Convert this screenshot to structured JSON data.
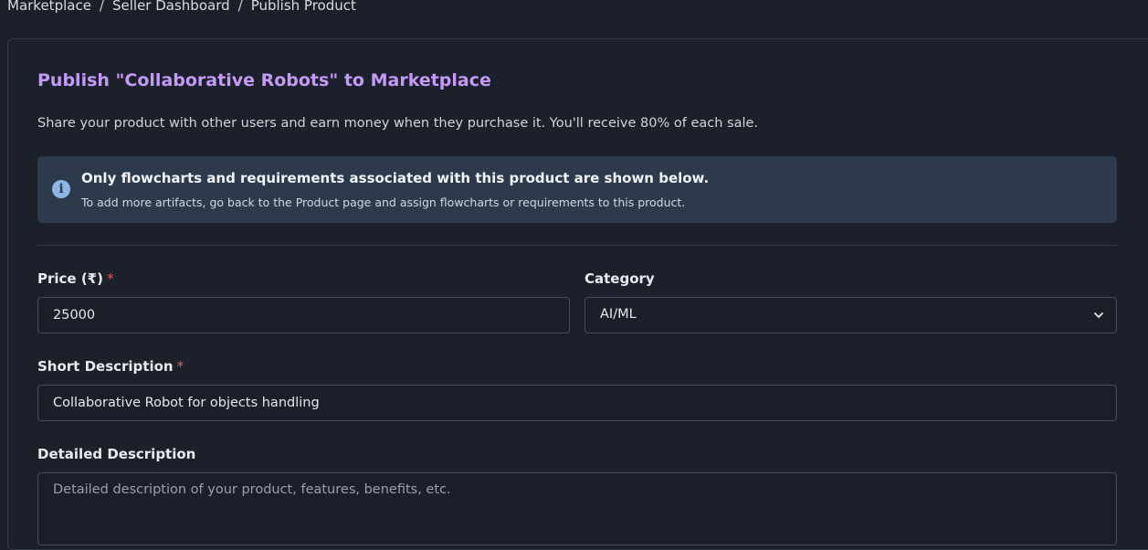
{
  "breadcrumb": {
    "items": [
      "Marketplace",
      "Seller Dashboard",
      "Publish Product"
    ],
    "separator": "/"
  },
  "header": {
    "title": "Publish \"Collaborative Robots\" to Marketplace",
    "subtitle": "Share your product with other users and earn money when they purchase it. You'll receive 80% of each sale."
  },
  "alert": {
    "icon": "info-icon",
    "title": "Only flowcharts and requirements associated with this product are shown below.",
    "body": "To add more artifacts, go back to the Product page and assign flowcharts or requirements to this product."
  },
  "form": {
    "price": {
      "label": "Price (₹)",
      "required_mark": "*",
      "value": "25000"
    },
    "category": {
      "label": "Category",
      "value": "AI/ML"
    },
    "short_description": {
      "label": "Short Description",
      "required_mark": "*",
      "value": "Collaborative Robot for objects handling"
    },
    "detailed_description": {
      "label": "Detailed Description",
      "value": "",
      "placeholder": "Detailed description of your product, features, benefits, etc."
    }
  },
  "colors": {
    "accent_title": "#c39af5",
    "required": "#e05a5a",
    "alert_bg": "#2d3a4c",
    "page_bg": "#1b1f2a"
  }
}
